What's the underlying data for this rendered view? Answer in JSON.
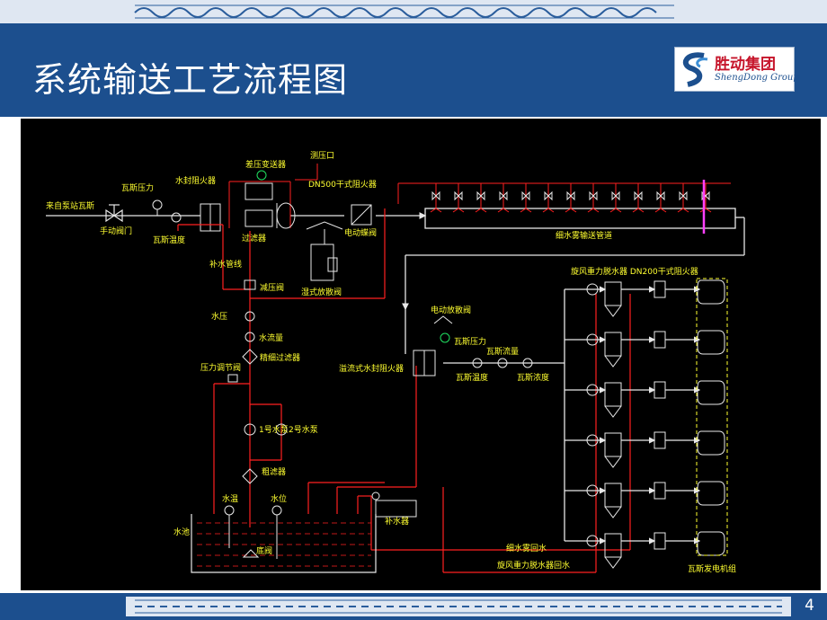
{
  "slide": {
    "title": "系统输送工艺流程图",
    "page_number": "4"
  },
  "logo": {
    "name_cn": "胜动集团",
    "name_en": "ShengDong Group"
  },
  "diagram": {
    "labels": {
      "source_gas": "来自泵站瓦斯",
      "gas_pressure_1": "瓦斯压力",
      "hand_valve": "手动阀门",
      "gas_temp_1": "瓦斯温度",
      "water_seal_arrester": "水封阻火器",
      "dp_transmitter": "差压变送器",
      "pressure_port": "测压口",
      "dn500_arrester": "DN500干式阻火器",
      "filter": "过滤器",
      "electric_butterfly": "电动蝶阀",
      "wet_relief_valve": "湿式放散阀",
      "mist_pipe": "细水雾输送管道",
      "makeup_pipe": "补水管线",
      "reducing_valve": "减压阀",
      "water_pressure": "水压",
      "water_flow": "水流量",
      "pressure_reg_valve": "压力调节阀",
      "fine_filter": "精细过滤器",
      "pump1": "1号水泵",
      "pump2": "2号水泵",
      "coarse_filter": "粗滤器",
      "water_temp": "水温",
      "water_level": "水位",
      "bottom_valve": "底阀",
      "pool": "水池",
      "makeup_tank": "补水器",
      "elec_relief_valve": "电动放散阀",
      "overflow_arrester": "溢流式水封阻火器",
      "gas_pressure_2": "瓦斯压力",
      "gas_flow": "瓦斯流量",
      "gas_temp_2": "瓦斯温度",
      "gas_conc": "瓦斯浓度",
      "cyclone_dewater_header": "旋风重力脱水器 DN200干式阻火器",
      "mist_return": "细水雾回水",
      "cyclone_return": "旋风重力脱水器回水",
      "gen_set": "瓦斯发电机组"
    },
    "colors": {
      "background": "#000000",
      "pipe_red": "#ff2020",
      "pipe_white": "#e8e8e8",
      "label_yellow": "#ffff30",
      "water_blue": "#3050ff",
      "device_green": "#20e060",
      "accent_magenta": "#ff40ff"
    }
  }
}
